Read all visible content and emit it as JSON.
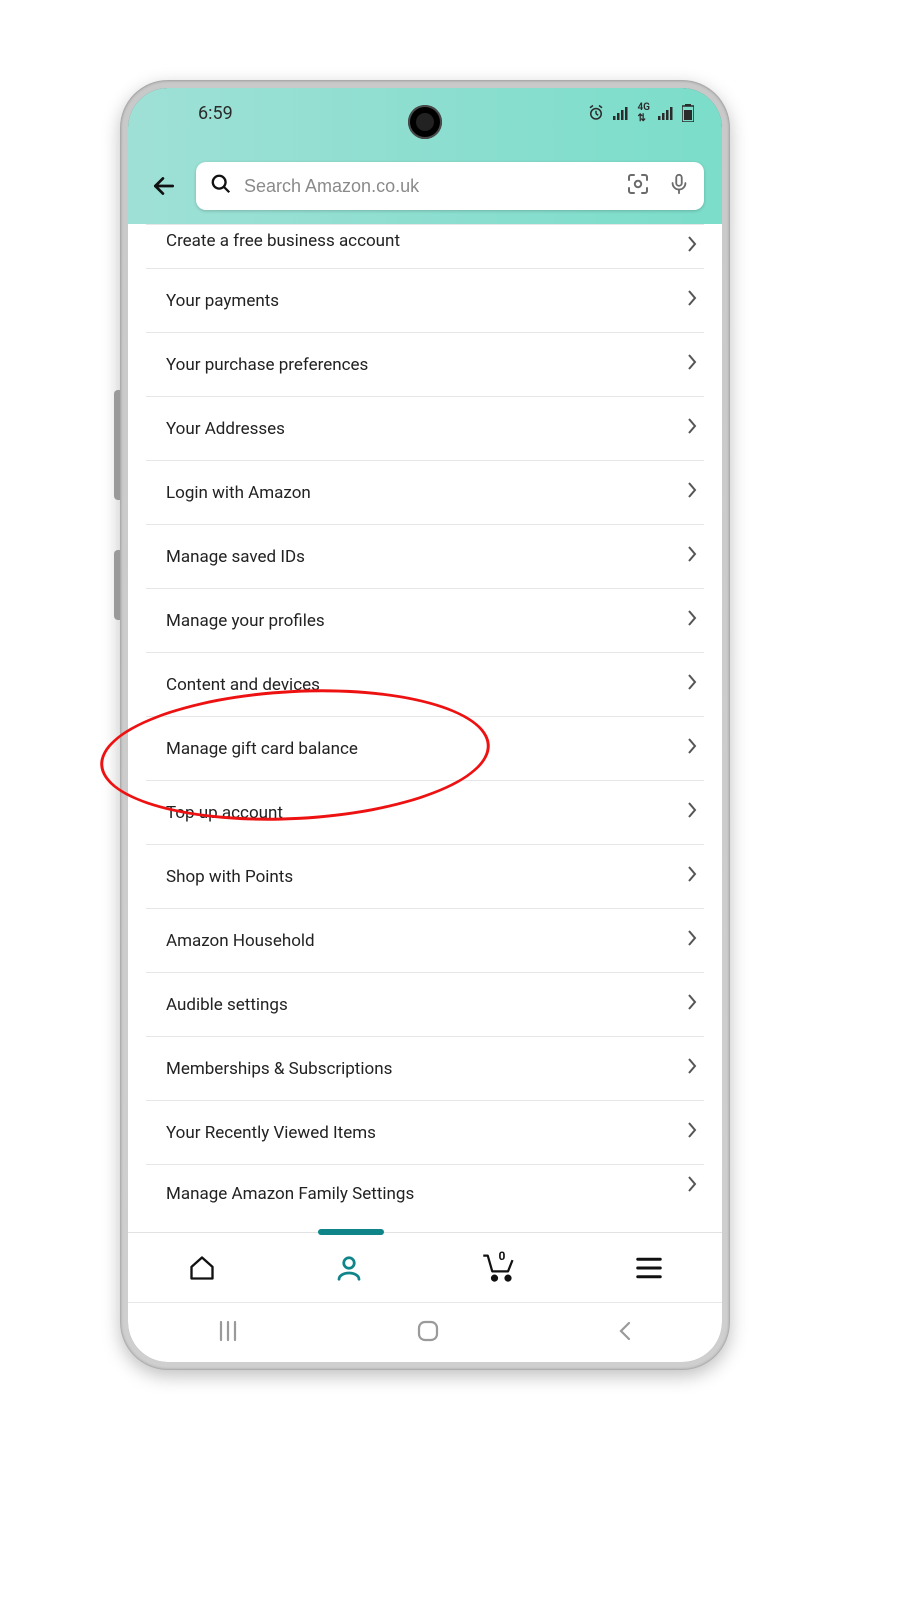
{
  "status": {
    "time": "6:59"
  },
  "search": {
    "placeholder": "Search Amazon.co.uk"
  },
  "menu": {
    "items": [
      {
        "label": "Create a free business account"
      },
      {
        "label": "Your payments"
      },
      {
        "label": "Your purchase preferences"
      },
      {
        "label": "Your Addresses"
      },
      {
        "label": "Login with Amazon"
      },
      {
        "label": "Manage saved IDs"
      },
      {
        "label": "Manage your profiles"
      },
      {
        "label": "Content and devices"
      },
      {
        "label": "Manage gift card balance"
      },
      {
        "label": "Top up account"
      },
      {
        "label": "Shop with Points"
      },
      {
        "label": "Amazon Household"
      },
      {
        "label": "Audible settings"
      },
      {
        "label": "Memberships & Subscriptions"
      },
      {
        "label": "Your Recently Viewed Items"
      },
      {
        "label": "Manage Amazon Family Settings"
      }
    ]
  },
  "cart": {
    "count": "0"
  },
  "callout": {
    "highlighted_item_index": 8
  }
}
